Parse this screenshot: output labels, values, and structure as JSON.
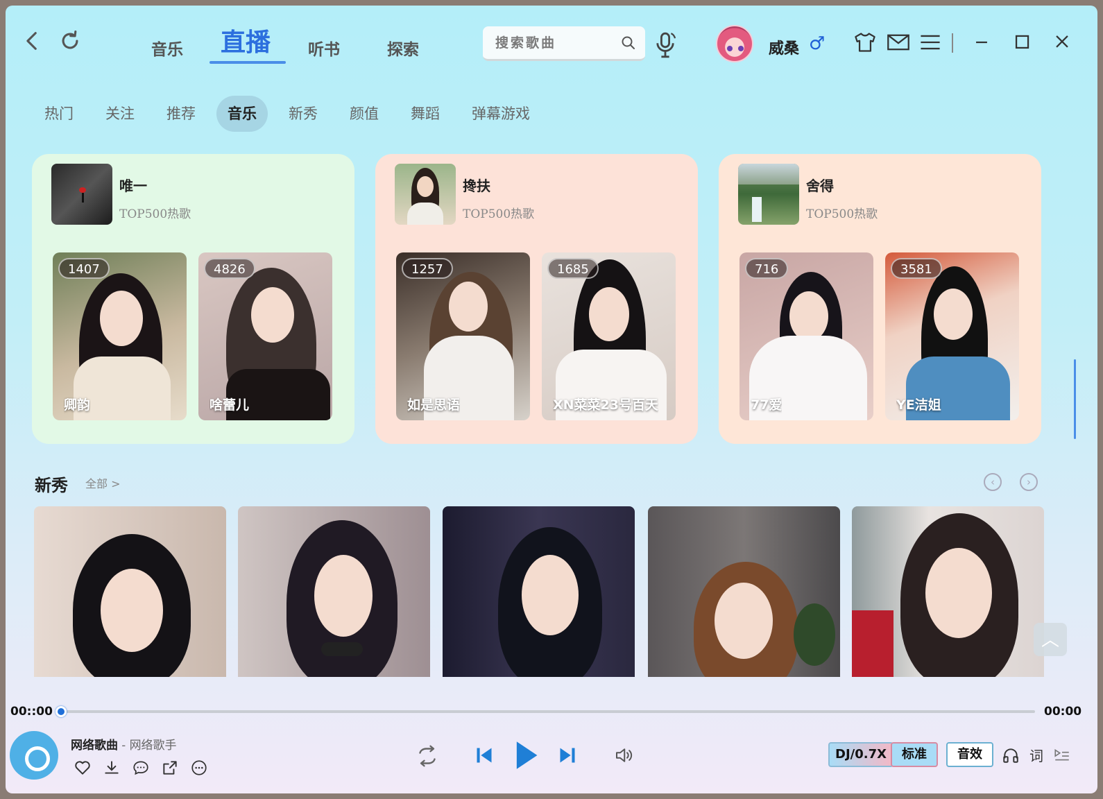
{
  "nav": {
    "tabs": [
      {
        "label": "音乐"
      },
      {
        "label": "直播"
      },
      {
        "label": "听书"
      },
      {
        "label": "探索"
      }
    ]
  },
  "search": {
    "placeholder": "搜索歌曲"
  },
  "user": {
    "name": "威桑",
    "gender_symbol": "♂"
  },
  "subtabs": [
    "热门",
    "关注",
    "推荐",
    "音乐",
    "新秀",
    "颜值",
    "舞蹈",
    "弹幕游戏"
  ],
  "playlists": [
    {
      "title": "唯一",
      "subtitle": "TOP500热歌",
      "bg": "#e2f9e6",
      "streams": [
        {
          "count": "1407",
          "name": "卿韵"
        },
        {
          "count": "4826",
          "name": "啥蕾儿"
        }
      ]
    },
    {
      "title": "搀扶",
      "subtitle": "TOP500热歌",
      "bg": "#fde2d8",
      "streams": [
        {
          "count": "1257",
          "name": "如是思语"
        },
        {
          "count": "1685",
          "name": "XN菜菜23号百天"
        }
      ]
    },
    {
      "title": "舍得",
      "subtitle": "TOP500热歌",
      "bg": "#fee6d7",
      "streams": [
        {
          "count": "716",
          "name": "77爱"
        },
        {
          "count": "3581",
          "name": "YE洁姐"
        }
      ]
    }
  ],
  "section": {
    "title": "新秀",
    "more": "全部 >"
  },
  "player": {
    "time_current": "00::00",
    "time_total": "00:00",
    "progress": 0,
    "song_name": "网络歌曲",
    "separator": " - ",
    "artist": "网络歌手",
    "dj_label": "DJ/0.7X",
    "quality_label": "标准",
    "effect_label": "音效",
    "lyric_label": "词"
  },
  "colors": {
    "accent": "#2c6fde",
    "subtab_active": "#a6d5e4"
  }
}
